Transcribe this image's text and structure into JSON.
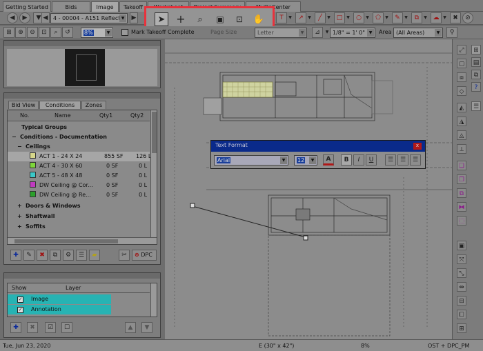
{
  "tabs": [
    {
      "label": "Getting Started",
      "active": false
    },
    {
      "label": "Bids",
      "active": false
    },
    {
      "label": "Image",
      "active": true
    },
    {
      "label": "Takeoff",
      "active": false
    },
    {
      "label": "Worksheet",
      "active": false
    },
    {
      "label": "Project Summary",
      "active": false
    },
    {
      "label": "MyOnCenter",
      "active": false
    }
  ],
  "toolbar1": {
    "page_select": "4 - 00004 - A151 Reflecte"
  },
  "toolbar2": {
    "zoom_value": "8%",
    "mark_takeoff_label": "Mark Takeoff Complete",
    "page_size_label": "Page Size",
    "page_size_value": "Letter",
    "scale_value": "1/8\" = 1' 0\"",
    "area_label": "Area",
    "area_value": "(All Areas)"
  },
  "panel_tabs": [
    "Bid View",
    "Conditions",
    "Zones"
  ],
  "conditions_header": {
    "no": "No.",
    "name": "Name",
    "qty1": "Qty1",
    "qty2": "Qty2"
  },
  "conditions_tree": [
    {
      "label": "Typical Groups",
      "indent": 0,
      "expander": "",
      "bold": true
    },
    {
      "label": "Conditions - Documentation",
      "indent": 0,
      "expander": "−",
      "bold": true
    },
    {
      "label": "Ceilings",
      "indent": 1,
      "expander": "−",
      "bold": true
    }
  ],
  "ceilings": [
    {
      "name": "ACT 1 - 24 X 24",
      "qty1": "855 SF",
      "qty2": "126 L",
      "color": "#d6d68a",
      "selected": true
    },
    {
      "name": "ACT 4 - 30 X 60",
      "qty1": "0 SF",
      "qty2": "0 L",
      "color": "#7ed63a",
      "selected": false
    },
    {
      "name": "ACT 5 - 48 X 48",
      "qty1": "0 SF",
      "qty2": "0 L",
      "color": "#3ac8c8",
      "selected": false
    },
    {
      "name": "DW Ceiling @ Cor...",
      "qty1": "0 SF",
      "qty2": "0 L",
      "color": "#c03ac0",
      "selected": false
    },
    {
      "name": "DW Ceiling @ Re...",
      "qty1": "0 SF",
      "qty2": "0 L",
      "color": "#2aa02a",
      "selected": false
    }
  ],
  "groups": [
    {
      "label": "Doors & Windows",
      "expander": "+"
    },
    {
      "label": "Shaftwall",
      "expander": "+"
    },
    {
      "label": "Soffits",
      "expander": "+"
    }
  ],
  "dpc_label": "DPC",
  "layers_header": {
    "show": "Show",
    "layer": "Layer"
  },
  "layers": [
    {
      "name": "Image",
      "checked": true
    },
    {
      "name": "Annotation",
      "checked": true
    }
  ],
  "text_format": {
    "title": "Text Format",
    "font_value": "Arial",
    "size_value": "12",
    "bold_label": "B",
    "italic_label": "I",
    "underline_label": "U",
    "color_label": "A",
    "close_label": "x"
  },
  "status": {
    "date": "Tue, Jun 23, 2020",
    "page_size": "E (30\" x 42\")",
    "zoom": "8%",
    "user": "OST + DPC_PM"
  },
  "colors": {
    "highlight_box": "#e8323c",
    "dialog_title": "#0a2a8a",
    "close_button": "#b01818"
  }
}
